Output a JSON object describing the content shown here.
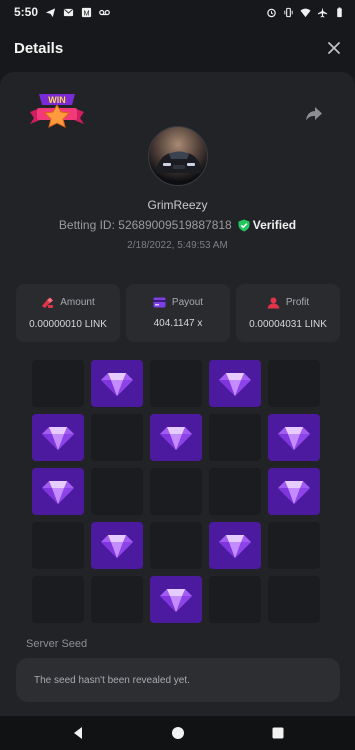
{
  "status_bar": {
    "time": "5:50",
    "left_icons": [
      "telegram-icon",
      "message-icon",
      "news-icon",
      "voicemail-icon"
    ],
    "right_icons": [
      "alarm-icon",
      "vibrate-icon",
      "wifi-icon",
      "airplane-icon",
      "battery-icon"
    ]
  },
  "header": {
    "title": "Details"
  },
  "details": {
    "username": "GrimReezy",
    "betting_id_label": "Betting ID: 52689009519887818",
    "verified_label": "Verified",
    "date": "2/18/2022, 5:49:53 AM",
    "badge_text": "WIN"
  },
  "stats": [
    {
      "label": "Amount",
      "value": "0.00000010 LINK",
      "icon": "amount-icon"
    },
    {
      "label": "Payout",
      "value": "404.1147 x",
      "icon": "card-icon"
    },
    {
      "label": "Profit",
      "value": "0.00004031 LINK",
      "icon": "profit-icon"
    }
  ],
  "grid": {
    "rows": 5,
    "cols": 5,
    "tiles": [
      0,
      1,
      0,
      1,
      0,
      1,
      0,
      1,
      0,
      1,
      1,
      0,
      0,
      0,
      1,
      0,
      1,
      0,
      1,
      0,
      0,
      0,
      1,
      0,
      0
    ]
  },
  "server_seed": {
    "label": "Server Seed",
    "message": "The seed hasn't been revealed yet."
  },
  "colors": {
    "gem_tile": "#4c1a9e",
    "empty_tile": "#1b1c1f",
    "verified": "#22c55e",
    "accent_red": "#e0344a",
    "accent_purple": "#7b3fe4"
  }
}
